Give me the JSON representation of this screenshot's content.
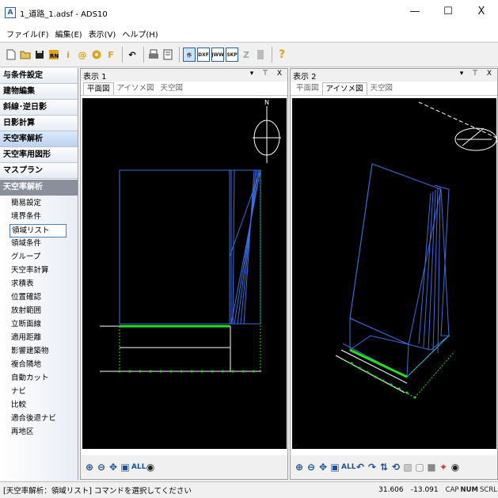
{
  "window": {
    "title": "1_道路_1.adsf - ADS10",
    "app_icon_letter": "A",
    "minimize": "—",
    "maximize": "☐",
    "close": "X"
  },
  "menu": [
    "ファイル(F)",
    "編集(E)",
    "表示(V)",
    "ヘルプ(H)"
  ],
  "toolbar": {
    "icons": [
      "new-file-icon",
      "open-folder-icon",
      "save-icon",
      "save-rn-icon",
      "info-icon",
      "at-icon",
      "gear-icon",
      "f-icon",
      "undo-icon",
      "print-icon",
      "document-icon"
    ],
    "boxes": [
      "作",
      "DXF",
      "JWW",
      "SKP"
    ],
    "active_box": "作",
    "extra": [
      "Z",
      "book-icon",
      "help-icon"
    ]
  },
  "sidebar": {
    "categories": [
      "与条件設定",
      "建物編集",
      "斜線･逆日影",
      "日影計算",
      "天空率解析",
      "天空率用図形",
      "マスプラン"
    ],
    "selected_category": "天空率解析",
    "sub_header": "天空率解析",
    "items": [
      "簡易設定",
      "境界条件",
      "領域リスト",
      "領域条件",
      "グループ",
      "天空率計算",
      "求積表",
      "位置確認",
      "放射範囲",
      "立断面線",
      "適用距離",
      "影響建築物",
      "複合隣地",
      "自動カット",
      "ナビ",
      "比較",
      "適合後退ナビ",
      "再地区"
    ],
    "selected_item": "領域リスト"
  },
  "view1": {
    "title": "表示 1",
    "controls": "▾ ⊤ X",
    "tabs": [
      "平面図",
      "アイソメ図",
      "天空図"
    ],
    "active_tab": "平面図",
    "footer_all": "ALL"
  },
  "view2": {
    "title": "表示 2",
    "controls": "▾ ⊤ X",
    "tabs": [
      "平面図",
      "アイソメ図",
      "天空図"
    ],
    "active_tab": "アイソメ図",
    "footer_all": "ALL"
  },
  "compass": {
    "north": "N"
  },
  "status": {
    "message": "[天空率解析：領域リスト] コマンドを選択してください",
    "x": "31.606",
    "y": "-13.091",
    "indicators": [
      "CAP",
      "NUM",
      "SCRL"
    ]
  },
  "colors": {
    "canvas": "#000000",
    "building": "#3b6de0",
    "highlight": "#22e01c",
    "lines": "#ffffff",
    "accent": "#2b5ea8"
  }
}
